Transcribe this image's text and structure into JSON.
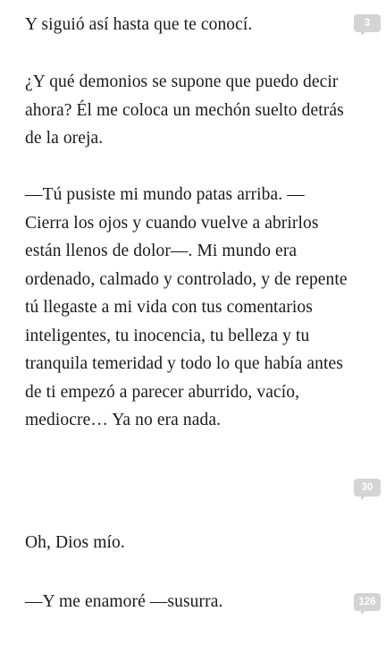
{
  "reader": {
    "paragraphs": [
      {
        "text": "Y siguió así hasta que te conocí.",
        "comments": "3"
      },
      {
        "text": "¿Y qué demonios se supone que puedo decir ahora? Él me coloca un mechón suelto detrás de la oreja.",
        "comments": ""
      },
      {
        "text": "—Tú pusiste mi mundo patas arriba. —Cierra los ojos y cuando vuelve a abrirlos están llenos de dolor—. Mi mundo era ordenado, calmado y controlado, y de repente tú llegaste a mi vida con tus comentarios inteligentes, tu inocencia, tu belleza y tu tranquila temeridad y todo lo que había antes de ti empezó a parecer aburrido, vacío, mediocre… Ya no era nada.",
        "comments": "30"
      },
      {
        "text": "Oh, Dios mío.",
        "comments": ""
      },
      {
        "text": "—Y me enamoré —susurra.",
        "comments": "126"
      }
    ]
  },
  "colors": {
    "text": "#1a1a1a",
    "badge": "#d4d4d4",
    "badge_text": "#ffffff",
    "background": "#ffffff"
  },
  "icons": {
    "comment_badge": "speech-bubble-icon"
  }
}
